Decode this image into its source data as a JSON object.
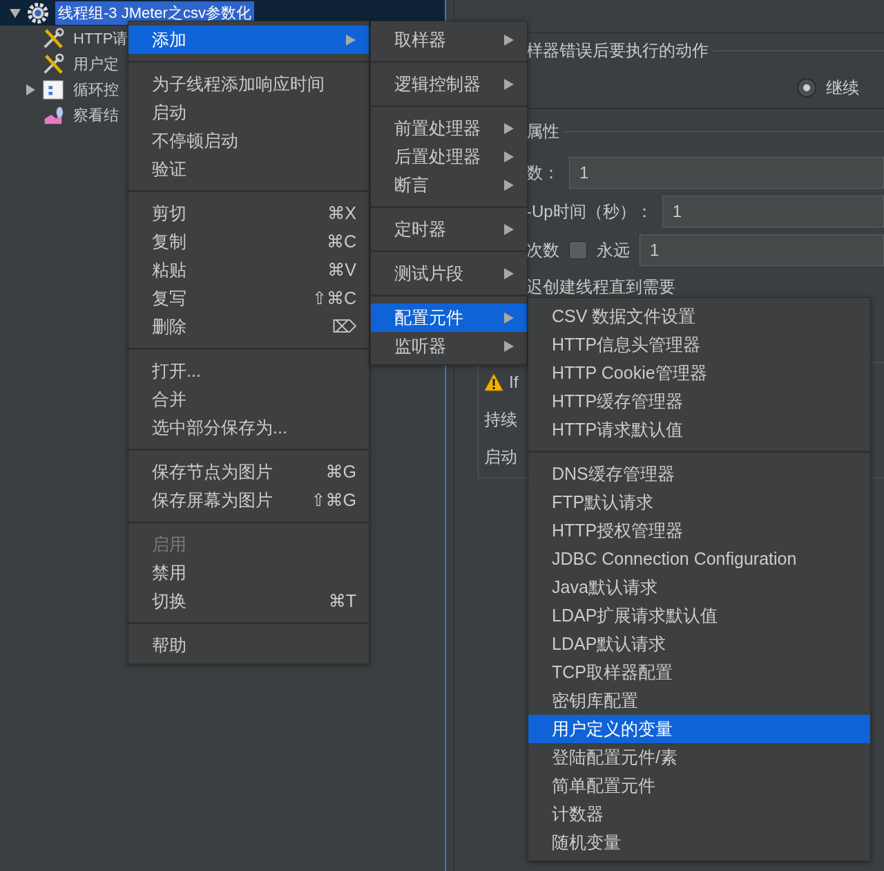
{
  "tree": [
    {
      "label": "线程组-3 JMeter之csv参数化",
      "kind": "thread-group",
      "expanded": true,
      "selected": true,
      "children": [
        {
          "label": "HTTP请",
          "kind": "sampler",
          "selected": false
        },
        {
          "label": "用户定",
          "kind": "sampler",
          "selected": false
        },
        {
          "label": "循环控",
          "kind": "controller",
          "expanded": false,
          "selected": false
        },
        {
          "label": "察看结",
          "kind": "listener",
          "selected": false
        }
      ]
    }
  ],
  "panel": {
    "error_action_legend": "样器错误后要执行的动作",
    "radio": {
      "label": "继续",
      "selected": true
    },
    "properties_legend": "属性",
    "fields": [
      {
        "label": "数：",
        "value": "1"
      },
      {
        "label": "-Up时间（秒）：",
        "value": "1"
      },
      {
        "label": "次数",
        "checkbox": {
          "label": "永远",
          "checked": false
        },
        "value": "1"
      }
    ],
    "delay_label": "迟创建线程直到需要",
    "warning": "If",
    "duration_label": "持续",
    "startup_label": "启动"
  },
  "context_menu": [
    [
      {
        "label": "添加",
        "submenu": true,
        "selected": true,
        "disabled": false
      }
    ],
    [
      {
        "label": "为子线程添加响应时间",
        "selected": false,
        "disabled": false
      },
      {
        "label": "启动",
        "selected": false,
        "disabled": false
      },
      {
        "label": "不停顿启动",
        "selected": false,
        "disabled": false
      },
      {
        "label": "验证",
        "selected": false,
        "disabled": false
      }
    ],
    [
      {
        "label": "剪切",
        "shortcut": "⌘X",
        "selected": false,
        "disabled": false
      },
      {
        "label": "复制",
        "shortcut": "⌘C",
        "selected": false,
        "disabled": false
      },
      {
        "label": "粘贴",
        "shortcut": "⌘V",
        "selected": false,
        "disabled": false
      },
      {
        "label": "复写",
        "shortcut": "⇧⌘C",
        "selected": false,
        "disabled": false
      },
      {
        "label": "删除",
        "shortcut": "⌦",
        "selected": false,
        "disabled": false
      }
    ],
    [
      {
        "label": "打开...",
        "selected": false,
        "disabled": false
      },
      {
        "label": "合并",
        "selected": false,
        "disabled": false
      },
      {
        "label": "选中部分保存为...",
        "selected": false,
        "disabled": false
      }
    ],
    [
      {
        "label": "保存节点为图片",
        "shortcut": "⌘G",
        "selected": false,
        "disabled": false
      },
      {
        "label": "保存屏幕为图片",
        "shortcut": "⇧⌘G",
        "selected": false,
        "disabled": false
      }
    ],
    [
      {
        "label": "启用",
        "selected": false,
        "disabled": true
      },
      {
        "label": "禁用",
        "selected": false,
        "disabled": false
      },
      {
        "label": "切换",
        "shortcut": "⌘T",
        "selected": false,
        "disabled": false
      }
    ],
    [
      {
        "label": "帮助",
        "selected": false,
        "disabled": false
      }
    ]
  ],
  "add_submenu": [
    [
      {
        "label": "取样器",
        "selected": false
      }
    ],
    [
      {
        "label": "逻辑控制器",
        "selected": false
      }
    ],
    [
      {
        "label": "前置处理器",
        "selected": false
      },
      {
        "label": "后置处理器",
        "selected": false
      },
      {
        "label": "断言",
        "selected": false
      }
    ],
    [
      {
        "label": "定时器",
        "selected": false
      }
    ],
    [
      {
        "label": "测试片段",
        "selected": false
      }
    ],
    [
      {
        "label": "配置元件",
        "selected": true
      },
      {
        "label": "监听器",
        "selected": false
      }
    ]
  ],
  "config_submenu": [
    [
      {
        "label": "CSV 数据文件设置",
        "selected": false
      },
      {
        "label": "HTTP信息头管理器",
        "selected": false
      },
      {
        "label": "HTTP Cookie管理器",
        "selected": false
      },
      {
        "label": "HTTP缓存管理器",
        "selected": false
      },
      {
        "label": "HTTP请求默认值",
        "selected": false
      }
    ],
    [
      {
        "label": "DNS缓存管理器",
        "selected": false
      },
      {
        "label": "FTP默认请求",
        "selected": false
      },
      {
        "label": "HTTP授权管理器",
        "selected": false
      },
      {
        "label": "JDBC Connection Configuration",
        "selected": false
      },
      {
        "label": "Java默认请求",
        "selected": false
      },
      {
        "label": "LDAP扩展请求默认值",
        "selected": false
      },
      {
        "label": "LDAP默认请求",
        "selected": false
      },
      {
        "label": "TCP取样器配置",
        "selected": false
      },
      {
        "label": "密钥库配置",
        "selected": false
      },
      {
        "label": "用户定义的变量",
        "selected": true
      },
      {
        "label": "登陆配置元件/素",
        "selected": false
      },
      {
        "label": "简单配置元件",
        "selected": false
      },
      {
        "label": "计数器",
        "selected": false
      },
      {
        "label": "随机变量",
        "selected": false
      }
    ]
  ]
}
